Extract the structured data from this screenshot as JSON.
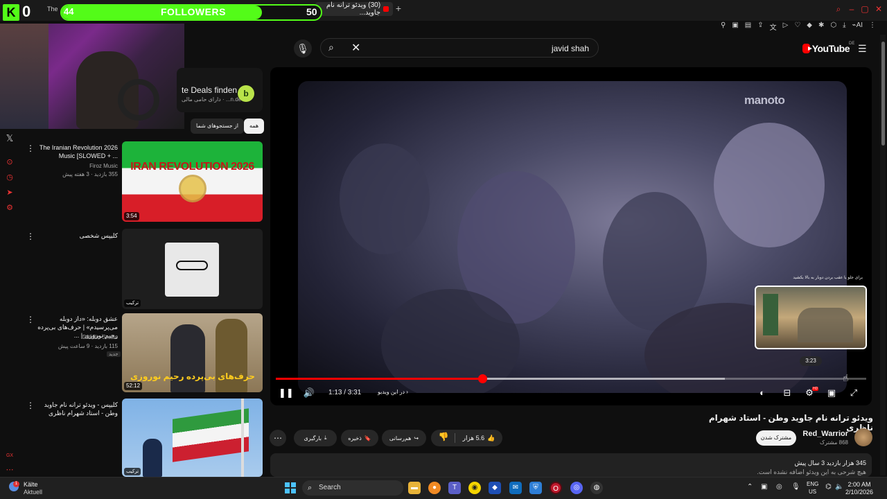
{
  "browser": {
    "active_tab_title": "(30) ویدئو ترانه نام جاوید...",
    "partial_tab_title": "The"
  },
  "stream_overlay": {
    "kick_logo": "K",
    "viewer_count": "0",
    "follower_goal_label": "FOLLOWERS",
    "follower_current": 44,
    "follower_goal": 50,
    "accent_color": "#53fc18"
  },
  "youtube": {
    "search_query": "javid shah",
    "logo_text": "YouTube",
    "logo_country": "DE",
    "ad": {
      "title": "te Deals finden",
      "subtitle": "دارای حامی مالی · ...n.de"
    },
    "chips": [
      "همه",
      "از جستجوهای شما"
    ],
    "related": [
      {
        "title": "The Iranian Revolution 2026 Music [SLOWED + ...",
        "channel": "Firoz Music",
        "meta": "355 بازدید · 3 هفته پیش",
        "duration": "3:54",
        "thumb_text": "IRAN REVOLUTION 2026"
      },
      {
        "title": "کلیپس شخصی",
        "channel": "",
        "meta": "",
        "duration": "ترکیب"
      },
      {
        "title": "عشق دوبله: «داز دوبله می‌پرسیدم» | حرف‌های بی‌پرده رحیم نوروزی | ...",
        "channel": "DubBin Studio",
        "meta": "115 بازدید · 9 ساعت پیش",
        "badge": "جدید",
        "duration": "52:12",
        "thumb_text": "حرف‌های بی‌پرده رحیم نوروزی"
      },
      {
        "title": "کلیپس - ویدئو ترانه نام جاوید وطن - استاد شهرام ناظری",
        "channel": "",
        "meta": "",
        "duration": "ترکیب"
      }
    ],
    "player": {
      "watermark": "manoto",
      "time_current": "1:13",
      "time_total": "3:31",
      "time_display": "1:13 / 3:31",
      "chapter_label": "در این ویدیو",
      "preview_hint": "برای جلو یا عقب بردن دوبار به بالا بکشید",
      "preview_time": "3:23",
      "progress_fraction": 0.35,
      "buffer_fraction": 0.76,
      "hd_badge": "HD"
    },
    "video": {
      "title": "ویدئو ترانه نام جاوید وطن - استاد شهرام ناظری",
      "channel": "Red_Warrior",
      "subscribers": "868 مشترک",
      "subscribe_label": "مشترک شدن",
      "likes": "5.6 هزار",
      "share_label": "هم‌رسانی",
      "save_label": "ذخیره",
      "download_label": "بارگیری",
      "stats": "345 هزار بازدید  3 سال پیش",
      "description": "هیچ شرحی به این ویدئو اضافه نشده است."
    }
  },
  "taskbar": {
    "weather_temp": "Kälte",
    "weather_cond": "Aktuell",
    "weather_badge": "1",
    "search_placeholder": "Search",
    "lang_top": "ENG",
    "lang_bottom": "US",
    "time": "2:00 AM",
    "date": "2/10/2026"
  }
}
